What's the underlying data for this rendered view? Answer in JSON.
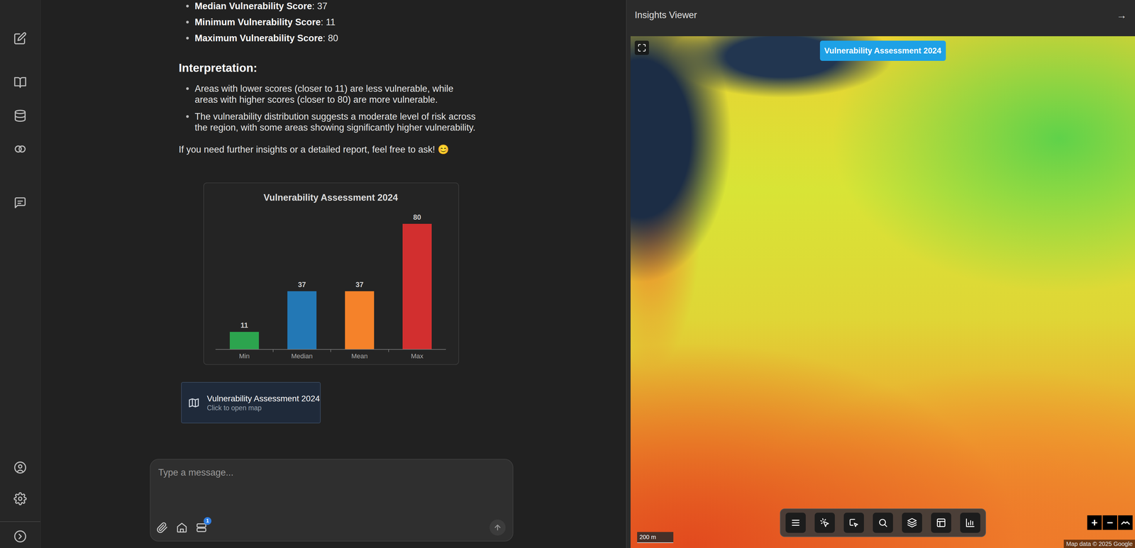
{
  "message": {
    "stats": [
      {
        "label": "Median Vulnerability Score",
        "rest": ": 37"
      },
      {
        "label": "Minimum Vulnerability Score",
        "rest": ": 11"
      },
      {
        "label": "Maximum Vulnerability Score",
        "rest": ": 80"
      }
    ],
    "heading": "Interpretation:",
    "bullets": [
      "Areas with lower scores (closer to 11) are less vulnerable, while areas with higher scores (closer to 80) are more vulnerable.",
      "The vulnerability distribution suggests a moderate level of risk across the region, with some areas showing significantly higher vulnerability."
    ],
    "closing": "If you need further insights or a detailed report, feel free to ask! 😊"
  },
  "chart": {
    "title": "Vulnerability Assessment 2024",
    "bars": [
      {
        "label": "Min",
        "value": 11,
        "value_label": "11",
        "color": "#2ca44e"
      },
      {
        "label": "Median",
        "value": 37,
        "value_label": "37",
        "color": "#2378b5"
      },
      {
        "label": "Mean",
        "value": 37,
        "value_label": "37",
        "color": "#f5822a"
      },
      {
        "label": "Max",
        "value": 80,
        "value_label": "80",
        "color": "#d22f2f"
      }
    ]
  },
  "map_card": {
    "title": "Vulnerability Assessment 2024",
    "subtitle": "Click to open map"
  },
  "composer": {
    "placeholder": "Type a message...",
    "badge": "1"
  },
  "insights_viewer": {
    "title": "Insights Viewer",
    "collapse": "→"
  },
  "map": {
    "layer_label": "Vulnerability Assessment 2024",
    "scale": "200 m",
    "zoom_in": "+",
    "zoom_out": "−",
    "attribution": "Map data © 2025 Google"
  }
}
